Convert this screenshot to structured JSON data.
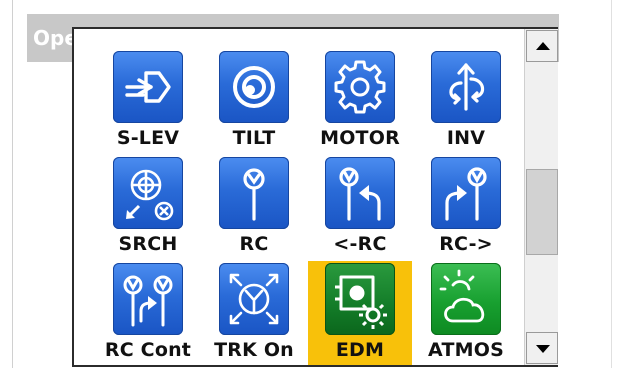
{
  "background_window": {
    "title": "Ope"
  },
  "menu": {
    "items": [
      {
        "label": "S-LEV",
        "icon": "level-arrow-icon",
        "color": "blue",
        "selected": false
      },
      {
        "label": "TILT",
        "icon": "tilt-bubble-icon",
        "color": "blue",
        "selected": false
      },
      {
        "label": "MOTOR",
        "icon": "gear-icon",
        "color": "blue",
        "selected": false
      },
      {
        "label": "INV",
        "icon": "invert-arrows-icon",
        "color": "blue",
        "selected": false
      },
      {
        "label": "SRCH",
        "icon": "search-target-icon",
        "color": "blue",
        "selected": false
      },
      {
        "label": "RC",
        "icon": "prism-pole-icon",
        "color": "blue",
        "selected": false
      },
      {
        "label": "<-RC",
        "icon": "prism-turn-left-icon",
        "color": "blue",
        "selected": false
      },
      {
        "label": "RC->",
        "icon": "prism-turn-right-icon",
        "color": "blue",
        "selected": false
      },
      {
        "label": "RC Cont",
        "icon": "prism-continuous-icon",
        "color": "blue",
        "selected": false
      },
      {
        "label": "TRK On",
        "icon": "tracking-target-icon",
        "color": "blue",
        "selected": false
      },
      {
        "label": "EDM",
        "icon": "edm-settings-icon",
        "color": "dark-green",
        "selected": true
      },
      {
        "label": "ATMOS",
        "icon": "weather-icon",
        "color": "green",
        "selected": false
      }
    ]
  },
  "scrollbar": {
    "up_icon": "triangle-up-icon",
    "down_icon": "triangle-down-icon"
  },
  "colors": {
    "selection": "#f8c10a",
    "blue_icon": "#2a6bd8",
    "green_icon": "#18a030"
  }
}
